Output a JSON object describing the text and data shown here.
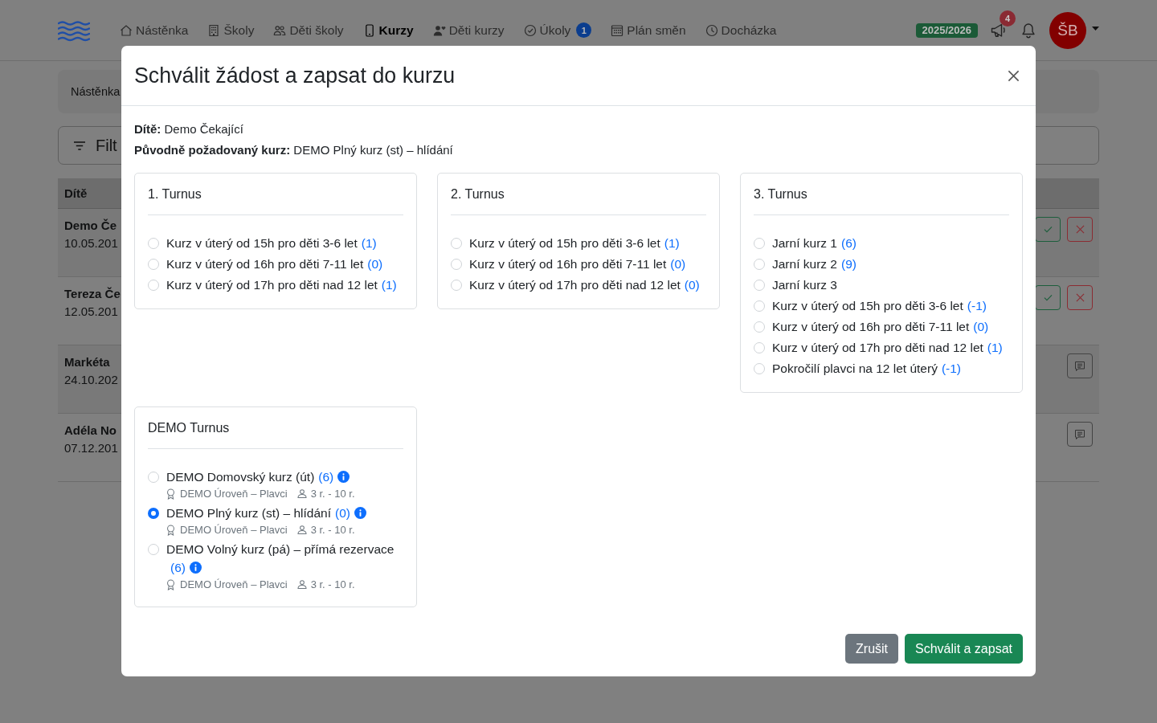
{
  "navbar": {
    "items": [
      {
        "label": "Nástěnka",
        "selected": false
      },
      {
        "label": "Školy",
        "selected": false
      },
      {
        "label": "Děti školy",
        "selected": false
      },
      {
        "label": "Kurzy",
        "selected": true
      },
      {
        "label": "Děti kurzy",
        "selected": false
      },
      {
        "label": "Úkoly",
        "selected": false,
        "badge": "1"
      },
      {
        "label": "Plán směn",
        "selected": false
      },
      {
        "label": "Docházka",
        "selected": false
      }
    ],
    "season": "2025/2026",
    "announcements_badge": "4",
    "avatar_initials": "ŠB"
  },
  "background": {
    "breadcrumb": "Nástěnka",
    "filter_label": "Filt",
    "table": {
      "columns": [
        "Dítě"
      ],
      "rows": [
        {
          "kind": "request",
          "name": "Demo Če",
          "date": "10.05.201"
        },
        {
          "kind": "request",
          "name": "Tereza Če",
          "date": "12.05.201"
        },
        {
          "kind": "note",
          "name": "Markéta",
          "date": "24.10.202"
        },
        {
          "kind": "note",
          "name": "Adéla No",
          "date": "07.12.201"
        }
      ]
    }
  },
  "modal": {
    "title": "Schválit žádost a zapsat do kurzu",
    "info_lines": [
      "**Dítě:** Demo Čekající",
      "**Původně požadovaný kurz:** DEMO Plný kurz (st) – hlídání"
    ],
    "groups": [
      {
        "title": "1. Turnus",
        "courses": [
          {
            "kind": "plain",
            "name": "Kurz v úterý od 15h pro děti 3-6 let",
            "count": "(1)",
            "selected": false
          },
          {
            "kind": "plain",
            "name": "Kurz v úterý od 16h pro děti 7-11 let",
            "count": "(0)",
            "selected": false
          },
          {
            "kind": "plain",
            "name": "Kurz v úterý od 17h pro děti nad 12 let",
            "count": "(1)",
            "selected": false
          }
        ]
      },
      {
        "title": "2. Turnus",
        "courses": [
          {
            "kind": "plain",
            "name": "Kurz v úterý od 15h pro děti 3-6 let",
            "count": "(1)",
            "selected": false
          },
          {
            "kind": "plain",
            "name": "Kurz v úterý od 16h pro děti 7-11 let",
            "count": "(0)",
            "selected": false
          },
          {
            "kind": "plain",
            "name": "Kurz v úterý od 17h pro děti nad 12 let",
            "count": "(0)",
            "selected": false
          }
        ]
      },
      {
        "title": "3. Turnus",
        "courses": [
          {
            "kind": "plain",
            "name": "Jarní kurz 1",
            "count": "(6)",
            "selected": false
          },
          {
            "kind": "plain",
            "name": "Jarní kurz 2",
            "count": "(9)",
            "selected": false
          },
          {
            "kind": "plain",
            "name": "Jarní kurz 3",
            "selected": false
          },
          {
            "kind": "plain",
            "name": "Kurz v úterý od 15h pro děti 3-6 let",
            "count": "(-1)",
            "selected": false
          },
          {
            "kind": "plain",
            "name": "Kurz v úterý od 16h pro děti 7-11 let",
            "count": "(0)",
            "selected": false
          },
          {
            "kind": "plain",
            "name": "Kurz v úterý od 17h pro děti nad 12 let",
            "count": "(1)",
            "selected": false
          },
          {
            "kind": "plain",
            "name": "Pokročilí plavci na 12 let úterý",
            "count": "(-1)",
            "selected": false
          }
        ]
      },
      {
        "title": "DEMO Turnus",
        "courses": [
          {
            "kind": "detailed",
            "name": "DEMO Domovský kurz (út)",
            "count": "(6)",
            "category": "DEMO Úroveň – Plavci",
            "age_range": "3 r. - 10 r.",
            "selected": false
          },
          {
            "kind": "detailed",
            "name": "DEMO Plný kurz (st) – hlídání",
            "count": "(0)",
            "category": "DEMO Úroveň – Plavci",
            "age_range": "3 r. - 10 r.",
            "selected": true
          },
          {
            "kind": "detailed",
            "name": "DEMO Volný kurz (pá) – přímá rezervace",
            "count": "(6)",
            "category": "DEMO Úroveň – Plavci",
            "age_range": "3 r. - 10 r.",
            "selected": false
          }
        ]
      }
    ],
    "buttons": [
      {
        "kind": "secondary",
        "label": "Zrušit"
      },
      {
        "kind": "primary",
        "label": "Schválit a zapsat"
      }
    ]
  }
}
